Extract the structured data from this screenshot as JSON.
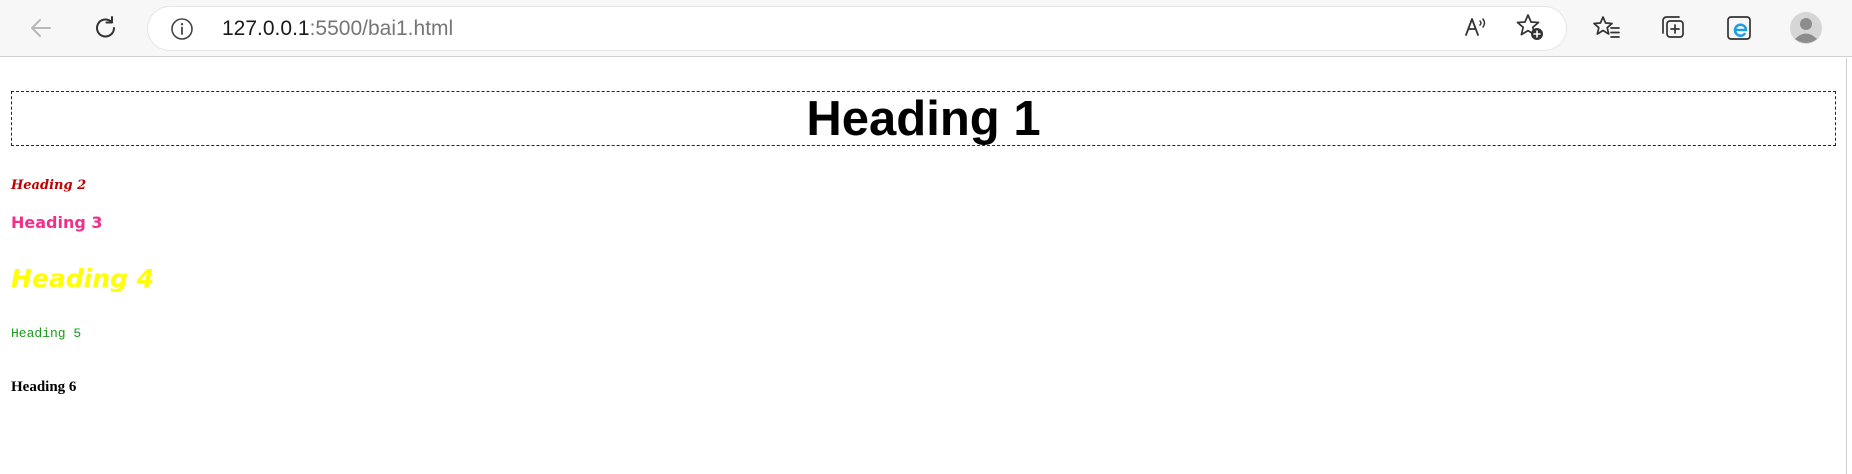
{
  "browser": {
    "address_host": "127.0.0.1",
    "address_path": ":5500/bai1.html",
    "icons": {
      "back": "arrow-left-icon",
      "reload": "reload-icon",
      "info": "info-icon",
      "read_aloud": "read-aloud-icon",
      "add_favorite": "star-plus-icon",
      "favorites": "favorites-list-icon",
      "collections": "collections-icon",
      "ie_mode": "ie-mode-icon",
      "profile": "avatar-icon"
    }
  },
  "page": {
    "h1": "Heading 1",
    "h2": "Heading 2",
    "h3": "Heading 3",
    "h4": "Heading 4",
    "h5": "Heading 5",
    "h6": "Heading 6",
    "colors": {
      "h1_border": "#1a0fb3",
      "h2": "#c00000",
      "h3": "#f2308a",
      "h4": "#ffff00",
      "h5": "#1a9a1a",
      "h6": "#000000"
    }
  }
}
